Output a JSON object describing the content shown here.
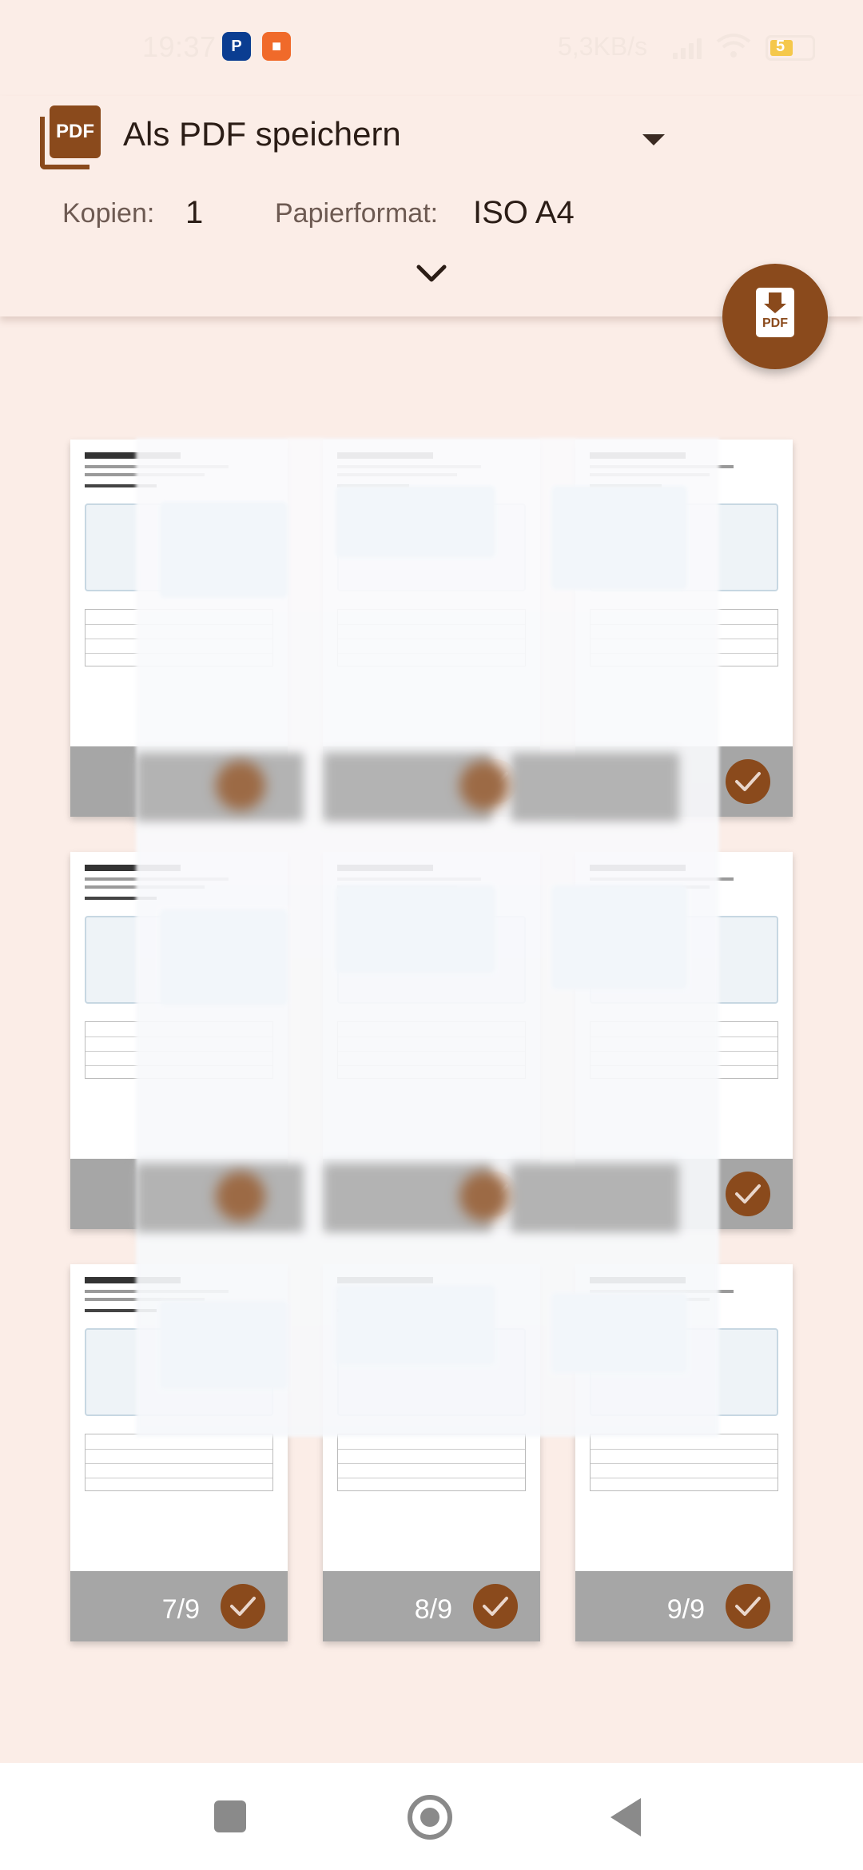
{
  "status_bar": {
    "time": "19:37",
    "network_speed": "5,3KB/s",
    "battery_level": "5",
    "paypal_icon": "paypal-icon",
    "video_icon": "video-icon"
  },
  "header": {
    "printer_name": "Als PDF speichern",
    "copies_label": "Kopien:",
    "copies_value": "1",
    "paper_label": "Papierformat:",
    "paper_value": "ISO A4",
    "pdf_icon_text": "PDF"
  },
  "fab": {
    "label": "PDF"
  },
  "pages": [
    {
      "number": "",
      "selected": true
    },
    {
      "number": "",
      "selected": true
    },
    {
      "number": "",
      "selected": true
    },
    {
      "number": "",
      "selected": true
    },
    {
      "number": "",
      "selected": true
    },
    {
      "number": "",
      "selected": true
    },
    {
      "number": "7/9",
      "selected": true
    },
    {
      "number": "8/9",
      "selected": true
    },
    {
      "number": "9/9",
      "selected": true
    }
  ],
  "colors": {
    "accent": "#8A4A1C",
    "background": "#FBEDE7",
    "footer": "#A6A6A6"
  }
}
